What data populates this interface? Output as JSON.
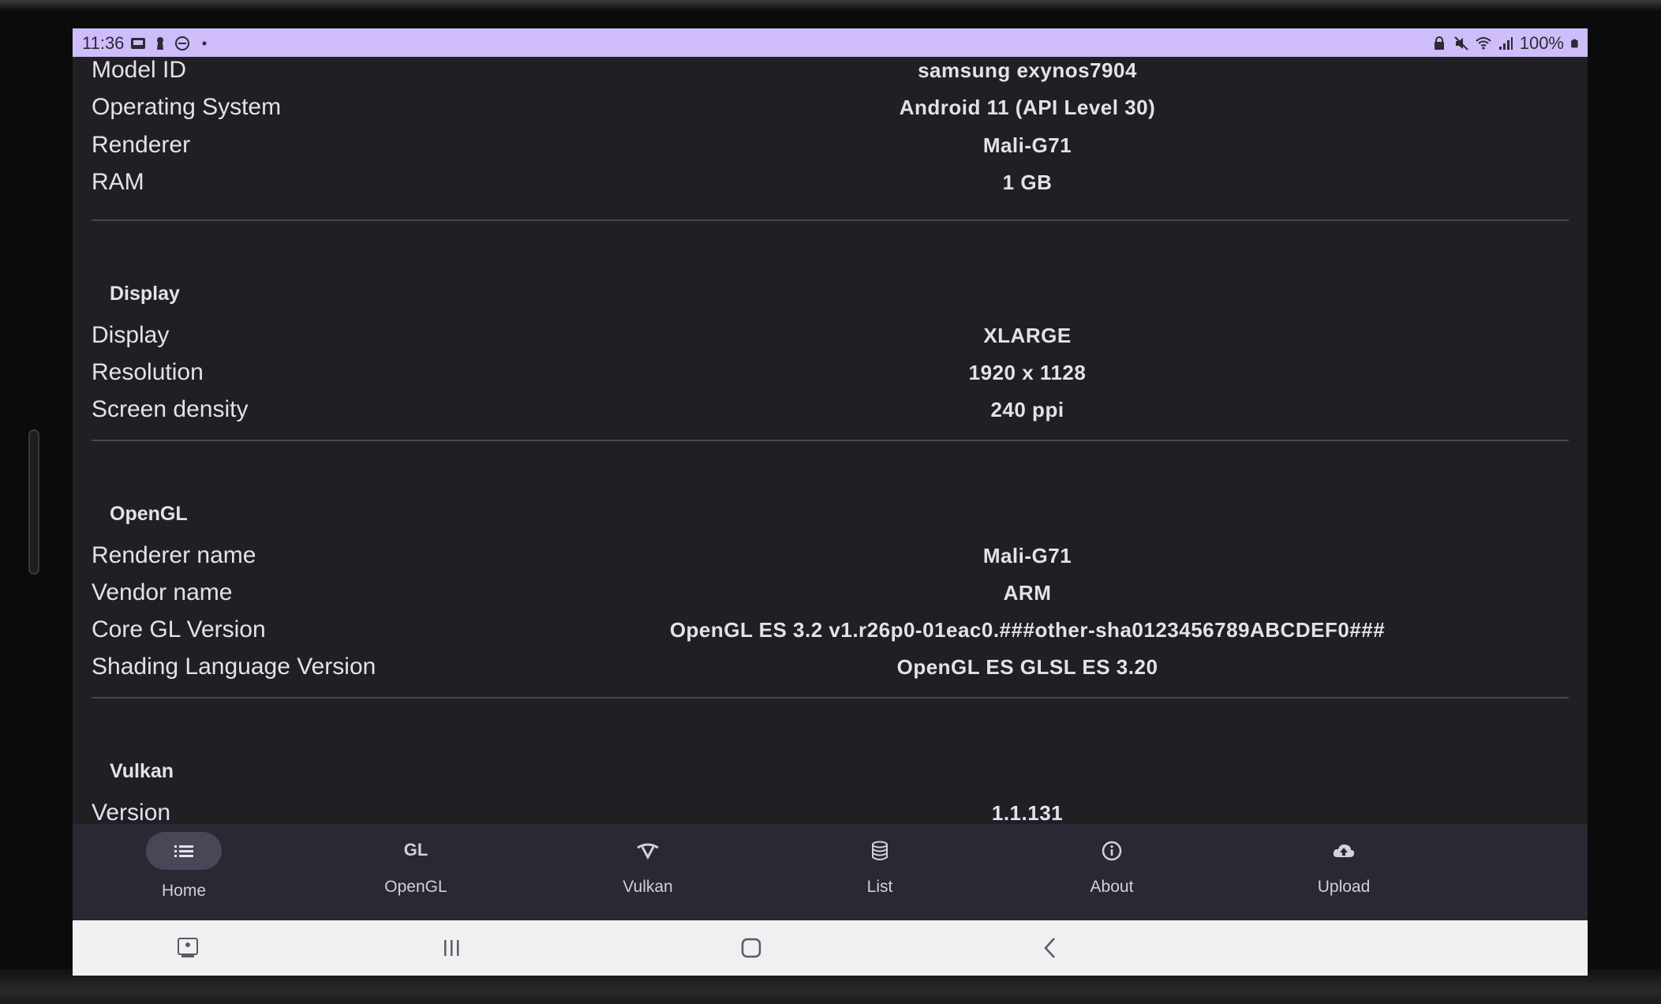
{
  "status_bar": {
    "time": "11:36",
    "left_icons": [
      "screenshot-icon",
      "keyhole-icon",
      "dnd-icon",
      "dot-icon"
    ],
    "battery": "100%",
    "right_icons": [
      "lock-icon",
      "mute-icon",
      "wifi-icon",
      "signal-icon",
      "battery-icon"
    ]
  },
  "system_rows": [
    {
      "label": "Model ID",
      "value": "samsung  exynos7904"
    },
    {
      "label": "Operating System",
      "value": "Android 11 (API Level 30)"
    },
    {
      "label": "Renderer",
      "value": "Mali-G71"
    },
    {
      "label": "RAM",
      "value": "1 GB"
    }
  ],
  "display": {
    "title": "Display",
    "rows": [
      {
        "label": "Display",
        "value": "XLARGE"
      },
      {
        "label": "Resolution",
        "value": "1920 x 1128"
      },
      {
        "label": "Screen density",
        "value": "240 ppi"
      }
    ]
  },
  "opengl": {
    "title": "OpenGL",
    "rows": [
      {
        "label": "Renderer name",
        "value": "Mali-G71"
      },
      {
        "label": "Vendor name",
        "value": "ARM"
      },
      {
        "label": "Core GL Version",
        "value": "OpenGL ES 3.2 v1.r26p0-01eac0.###other-sha0123456789ABCDEF0###"
      },
      {
        "label": "Shading Language Version",
        "value": "OpenGL ES GLSL ES 3.20"
      }
    ]
  },
  "vulkan": {
    "title": "Vulkan",
    "rows": [
      {
        "label": "Version",
        "value": "1.1.131"
      }
    ]
  },
  "bottom_nav": [
    {
      "label": "Home",
      "icon": "list-icon",
      "selected": true
    },
    {
      "label": "OpenGL",
      "icon": "gl-icon",
      "glyph": "GL",
      "selected": false
    },
    {
      "label": "Vulkan",
      "icon": "vulkan-icon",
      "selected": false
    },
    {
      "label": "List",
      "icon": "database-icon",
      "selected": false
    },
    {
      "label": "About",
      "icon": "info-icon",
      "selected": false
    },
    {
      "label": "Upload",
      "icon": "cloud-upload-icon",
      "selected": false
    }
  ],
  "system_nav": [
    "screen-icon",
    "recents-icon",
    "home-icon",
    "back-icon"
  ],
  "colors": {
    "status_bar_bg": "#cfbcfb",
    "background": "#201f24",
    "nav_bg": "#2a2833",
    "nav_selected_pill": "#4a4658",
    "text": "#e6e1e9",
    "divider": "#4a4850",
    "system_nav_bg": "#f0f0f2"
  }
}
